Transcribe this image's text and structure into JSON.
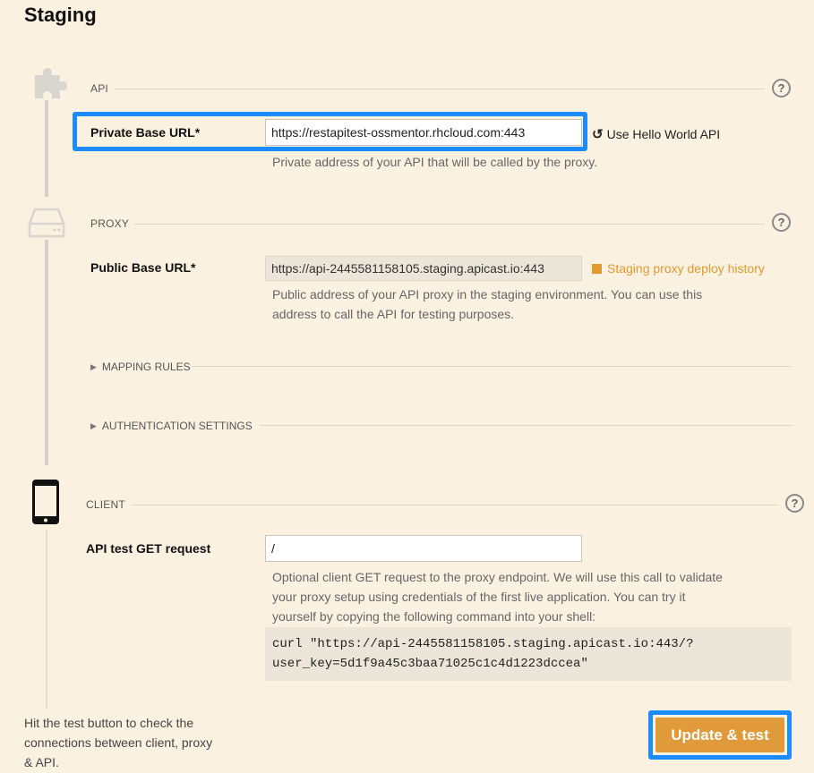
{
  "page": {
    "title": "Staging"
  },
  "api": {
    "section_label": "API",
    "help_icon": "?",
    "private_base_url": {
      "label": "Private Base URL*",
      "value": "https://restapitest-ossmentor.rhcloud.com:443",
      "hint": "Private address of your API that will be called by the proxy."
    },
    "hello_world_link": "Use Hello World API"
  },
  "proxy": {
    "section_label": "PROXY",
    "help_icon": "?",
    "public_base_url": {
      "label": "Public Base URL*",
      "value": "https://api-2445581158105.staging.apicast.io:443",
      "hint_line1": "Public address of your API proxy in the staging environment. You can use this",
      "hint_line2": "address to call the API for testing purposes."
    },
    "deploy_history_link": "Staging proxy deploy history",
    "mapping_rules": "MAPPING RULES",
    "auth_settings": "AUTHENTICATION SETTINGS"
  },
  "client": {
    "section_label": "CLIENT",
    "help_icon": "?",
    "api_test_get": {
      "label": "API test GET request",
      "value": "/",
      "hint_line1": "Optional client GET request to the proxy endpoint. We will use this call to validate",
      "hint_line2": "your proxy setup using credentials of the first live application. You can try it",
      "hint_line3": "yourself by copying the following command into your shell:"
    },
    "curl_line1": "curl \"https://api-2445581158105.staging.apicast.io:443/?",
    "curl_line2": "user_key=5d1f9a45c3baa71025c1c4d1223dccea\""
  },
  "footer": {
    "help_line1": "Hit the test button to check the",
    "help_line2": "connections between client, proxy",
    "help_line3": "& API.",
    "button_label": "Update & test"
  },
  "colors": {
    "accent_blue": "#1a8cff",
    "orange": "#e09a3a",
    "background": "#fbf1e1"
  },
  "icons": [
    "puzzle-icon",
    "server-icon",
    "phone-icon",
    "help-icon",
    "refresh-icon"
  ]
}
